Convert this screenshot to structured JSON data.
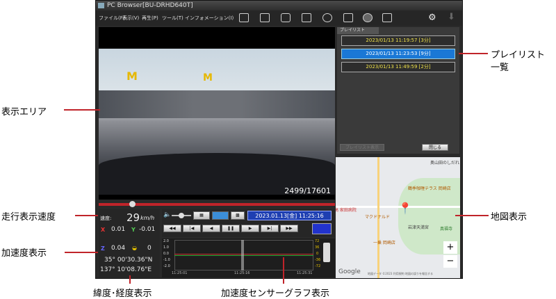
{
  "window": {
    "title": "PC Browser[BU-DRHD640T]",
    "menu": [
      "ファイル(F)",
      "表示(V)",
      "再生(P)",
      "ツール(T)",
      "インフォメーション(I)"
    ]
  },
  "video": {
    "frame_counter": "2499/17601"
  },
  "info": {
    "speed_label": "速度:",
    "speed_value": "29",
    "speed_unit": "km/h",
    "x_label": "X",
    "x_value": "0.01",
    "y_label": "Y",
    "y_value": "-0.01",
    "z_label": "Z",
    "z_value": "0.04",
    "extra_value": "0",
    "latitude": "35° 00'30.36\"N",
    "longitude": "137° 10'08.76\"E"
  },
  "controls": {
    "datetime": "2023.01.13[金] 11:25:16"
  },
  "graph": {
    "y_ticks": [
      "2.0",
      "1.0",
      "0.0",
      "-1.0",
      "-2.0"
    ],
    "right_ticks": [
      "72",
      "36",
      "0",
      "-36",
      "-72"
    ],
    "time_ticks": [
      "11:25:01",
      "11:25:16",
      "11:25:31"
    ]
  },
  "playlist": {
    "tab": "プレイリスト",
    "items": [
      {
        "label": "2023/01/13 11:19:57 [3分]",
        "selected": false
      },
      {
        "label": "2023/01/13 11:23:53 [9分]",
        "selected": true
      },
      {
        "label": "2023/01/13 11:49:59 [2分]",
        "selected": false
      }
    ],
    "left_button": "プレイリスト表示",
    "close_button": "閉じる"
  },
  "map": {
    "labels": [
      "奥山田のしだれ",
      "鶴季咖喱テラス 岡崎店",
      "岩津天満宮",
      "真福寺",
      "一乗 岡崎店",
      "マクドナルド",
      "高 家田病院"
    ],
    "google": "Google",
    "footer": "地図データ ©2023 利用規約 地図の誤りを報告する",
    "zoom_in": "+",
    "zoom_out": "−"
  },
  "callouts": {
    "display_area": "表示エリア",
    "speed": "走行表示速度",
    "accel": "加速度表示",
    "latlon": "緯度･経度表示",
    "sensor_graph": "加速度センサーグラフ表示",
    "playlist_line1": "プレイリスト",
    "playlist_line2": "一覧",
    "map": "地図表示"
  }
}
